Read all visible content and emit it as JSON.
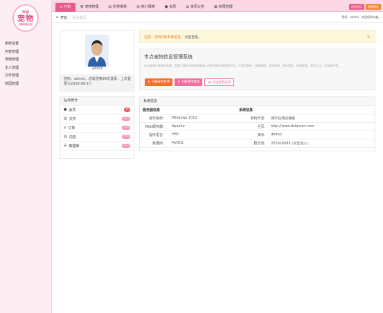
{
  "logo": {
    "top": "市点",
    "main": "宠物",
    "sub": "宠物管理平台"
  },
  "sidebar": {
    "items": [
      {
        "label": "系统设置"
      },
      {
        "label": "内容管理"
      },
      {
        "label": "宠物管理"
      },
      {
        "label": "主人管理"
      },
      {
        "label": "文件管理"
      },
      {
        "label": "校园管理"
      }
    ]
  },
  "nav": {
    "items": [
      {
        "icon": "home-icon",
        "label": "开始"
      },
      {
        "icon": "paw-icon",
        "label": "宠物管理"
      },
      {
        "icon": "file-icon",
        "label": "防类系统"
      },
      {
        "icon": "chart-icon",
        "label": "统计报表"
      },
      {
        "icon": "user-icon",
        "label": "会员"
      },
      {
        "icon": "doc-icon",
        "label": "资讯公告"
      },
      {
        "icon": "grid-icon",
        "label": "权限管理"
      }
    ]
  },
  "top_buttons": {
    "a": "返回首页",
    "b": "清除缓存"
  },
  "breadcrumb": {
    "home": "开始",
    "current": "后台首页"
  },
  "welcome": "您好，admin，欢迎您的光临。",
  "profile": {
    "name": "admin",
    "text": "您好，admin。这是您第99次登录，上次登录为2019-08-17。"
  },
  "stats": {
    "title": "站点统计",
    "rows": [
      {
        "icon": "user-icon",
        "label": "会员",
        "count": "46",
        "red": true
      },
      {
        "icon": "file-icon",
        "label": "文件",
        "count": "620"
      },
      {
        "icon": "cart-icon",
        "label": "订单",
        "count": "620"
      },
      {
        "icon": "doc-icon",
        "label": "内容",
        "count": "620"
      },
      {
        "icon": "database-icon",
        "label": "数据库",
        "count": "620"
      }
    ]
  },
  "alert": {
    "warn": "注意：您有0条未读信息，",
    "rest": "点击查看。",
    "close": "×"
  },
  "intro": {
    "title": "市点宠物信息管理系统",
    "desc": "市点宠物信息管理系统，是厦门城市在线科技有限公司的宠物信息管理平台，主要功能有：宠物管理、防类系统、统计报表、权限管理、资讯公告、系统维护等。",
    "btn1": "下载安装程序",
    "btn2": "下载使用教程",
    "btn3": "在线使用说明"
  },
  "sysinfo": {
    "title": "系统信息",
    "col1": "服务器信息",
    "col2": "系统信息",
    "rows": [
      [
        "操作系统：",
        "Windows 2012",
        "系统开发:",
        "城市在线前端组"
      ],
      [
        "Web服务器：",
        "Apache",
        "主页:",
        "http://www.dxiamen.com"
      ],
      [
        "程序语言：",
        "PHP",
        "演示:",
        "demo/"
      ],
      [
        "数据库：",
        "MySQL",
        "群交流:",
        "201916085 (点击加入)"
      ]
    ]
  }
}
